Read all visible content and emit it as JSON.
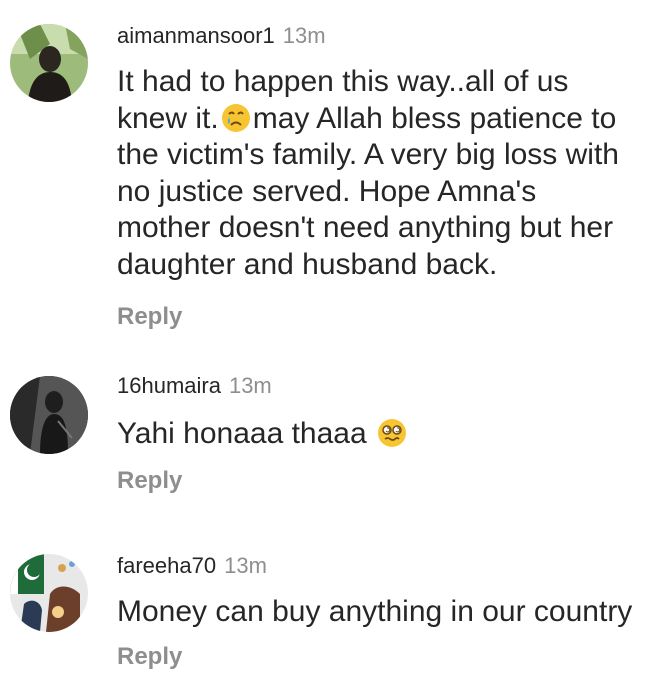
{
  "comments": [
    {
      "username": "aimanmansoor1",
      "time": "13m",
      "text_part1": "It had to happen this way..all of us knew it.",
      "emoji1": "crying-face",
      "text_part2": "may Allah bless patience to the victim's family. A very big loss with no justice served. Hope Amna's mother doesn't need anything but her daughter and husband back.",
      "reply": "Reply"
    },
    {
      "username": "16humaira",
      "time": "13m",
      "text": "Yahi honaaa thaaa",
      "emoji": "woozy-dizzy-face",
      "reply": "Reply"
    },
    {
      "username": "fareeha70",
      "time": "13m",
      "text": "Money can buy anything in our country",
      "reply": "Reply"
    }
  ],
  "colors": {
    "text": "#262626",
    "secondary": "#8e8e8e",
    "background": "#ffffff"
  }
}
